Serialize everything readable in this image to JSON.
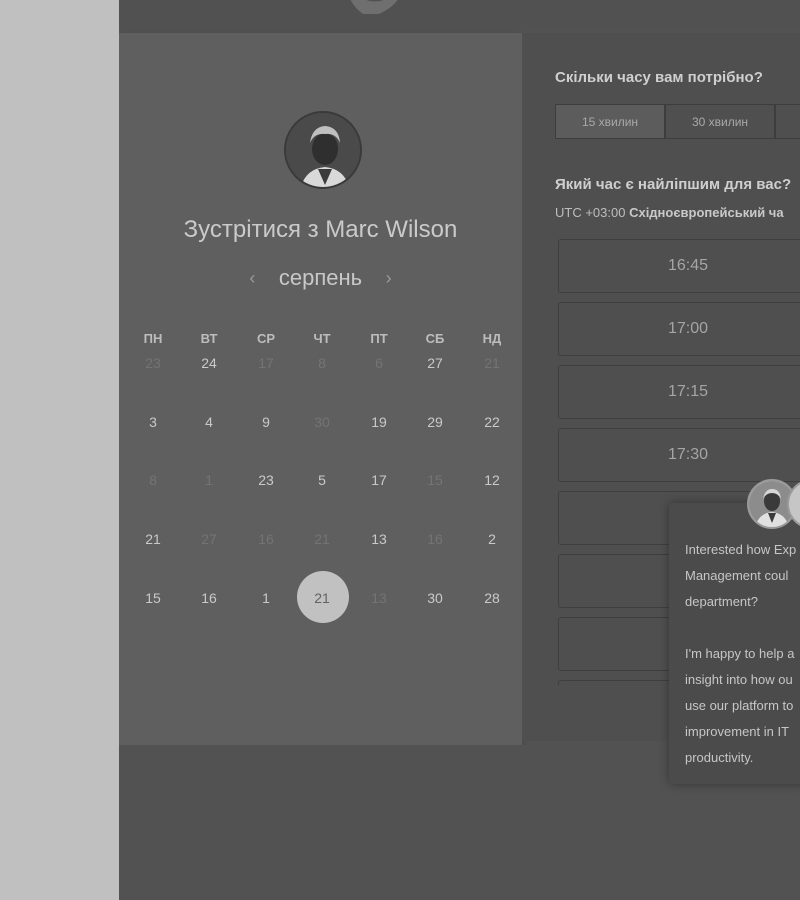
{
  "colors": {
    "page_background": "#c0c0c0",
    "panel_left": "#5f5f5f",
    "panel_right": "#4f4f4f",
    "selected_day": "#c1c1c1"
  },
  "icons": {
    "logo": "speech-bubble-logo-icon",
    "prev": "chevron-left-icon",
    "next": "chevron-right-icon"
  },
  "profile": {
    "meet_title": "Зустрітися з Marc Wilson"
  },
  "calendar": {
    "month": "серпень",
    "prev_arrow": "‹",
    "next_arrow": "›",
    "weekdays": [
      "ПН",
      "ВТ",
      "СР",
      "ЧТ",
      "ПТ",
      "СБ",
      "НД"
    ],
    "weeks": [
      [
        {
          "d": "23",
          "muted": true
        },
        {
          "d": "24",
          "muted": false
        },
        {
          "d": "17",
          "muted": true
        },
        {
          "d": "8",
          "muted": true
        },
        {
          "d": "6",
          "muted": true
        },
        {
          "d": "27",
          "muted": false
        },
        {
          "d": "21",
          "muted": true
        }
      ],
      [
        {
          "d": "3",
          "muted": false
        },
        {
          "d": "4",
          "muted": false
        },
        {
          "d": "9",
          "muted": false
        },
        {
          "d": "30",
          "muted": true
        },
        {
          "d": "19",
          "muted": false
        },
        {
          "d": "29",
          "muted": false
        },
        {
          "d": "22",
          "muted": false
        }
      ],
      [
        {
          "d": "8",
          "muted": true
        },
        {
          "d": "1",
          "muted": true
        },
        {
          "d": "23",
          "muted": false
        },
        {
          "d": "5",
          "muted": false
        },
        {
          "d": "17",
          "muted": false
        },
        {
          "d": "15",
          "muted": true
        },
        {
          "d": "12",
          "muted": false
        }
      ],
      [
        {
          "d": "21",
          "muted": false
        },
        {
          "d": "27",
          "muted": true
        },
        {
          "d": "16",
          "muted": true
        },
        {
          "d": "21",
          "muted": true
        },
        {
          "d": "13",
          "muted": false
        },
        {
          "d": "16",
          "muted": true
        },
        {
          "d": "2",
          "muted": false
        }
      ],
      [
        {
          "d": "15",
          "muted": false
        },
        {
          "d": "16",
          "muted": false
        },
        {
          "d": "1",
          "muted": false
        },
        {
          "d": "21",
          "muted": false,
          "selected": true
        },
        {
          "d": "13",
          "muted": true
        },
        {
          "d": "30",
          "muted": false
        },
        {
          "d": "28",
          "muted": false
        }
      ]
    ]
  },
  "duration": {
    "title": "Скільки часу вам потрібно?",
    "options": [
      "15 хвилин",
      "30 хвилин",
      ""
    ],
    "selected_index": 0
  },
  "times": {
    "title": "Який час є найліпшим для вас?",
    "timezone_offset": "UTC +03:00",
    "timezone_name": "Східноєвропейський ча",
    "slots": [
      "16:45",
      "17:00",
      "17:15",
      "17:30",
      "",
      "",
      "",
      ""
    ]
  },
  "chat": {
    "message": "Interested how Exp\nManagement coul\ndepartment?\n\nI'm happy to help a\ninsight into how ou\nuse our platform to\nimprovement in IT\nproductivity."
  }
}
